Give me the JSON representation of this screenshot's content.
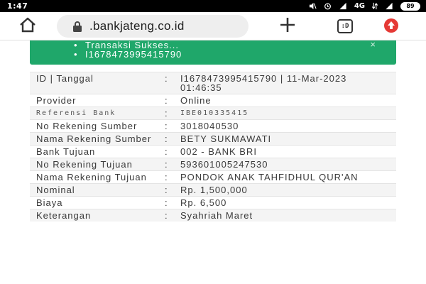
{
  "statusbar": {
    "time": "1:47",
    "network": "4G",
    "battery": "89"
  },
  "browser": {
    "url": ".bankjateng.co.id",
    "tabs_label": ":D",
    "icons": {
      "home": "home-icon",
      "lock": "lock-icon",
      "new_tab": "plus-icon",
      "tabs": "tab-switcher-icon",
      "update": "update-arrow-icon"
    }
  },
  "alert": {
    "messages": [
      "Transaksi Sukses...",
      "I1678473995415790"
    ],
    "close": "×",
    "color": "#1fa76a"
  },
  "details": [
    {
      "label": "ID | Tanggal",
      "value": "I1678473995415790 | 11-Mar-2023 01:46:35"
    },
    {
      "label": "Provider",
      "value": "Online"
    },
    {
      "label": "Referensi Bank",
      "value": "IBE010335415"
    },
    {
      "label": "No Rekening Sumber",
      "value": "3018040530"
    },
    {
      "label": "Nama Rekening Sumber",
      "value": "BETY SUKMAWATI"
    },
    {
      "label": "Bank Tujuan",
      "value": "002 - BANK BRI"
    },
    {
      "label": "No Rekening Tujuan",
      "value": "593601005247530"
    },
    {
      "label": "Nama Rekening Tujuan",
      "value": "PONDOK ANAK TAHFIDHUL QUR'AN"
    },
    {
      "label": "Nominal",
      "value": "Rp. 1,500,000"
    },
    {
      "label": "Biaya",
      "value": "Rp. 6,500"
    },
    {
      "label": "Keterangan",
      "value": "Syahriah Maret"
    }
  ],
  "colon": ":"
}
